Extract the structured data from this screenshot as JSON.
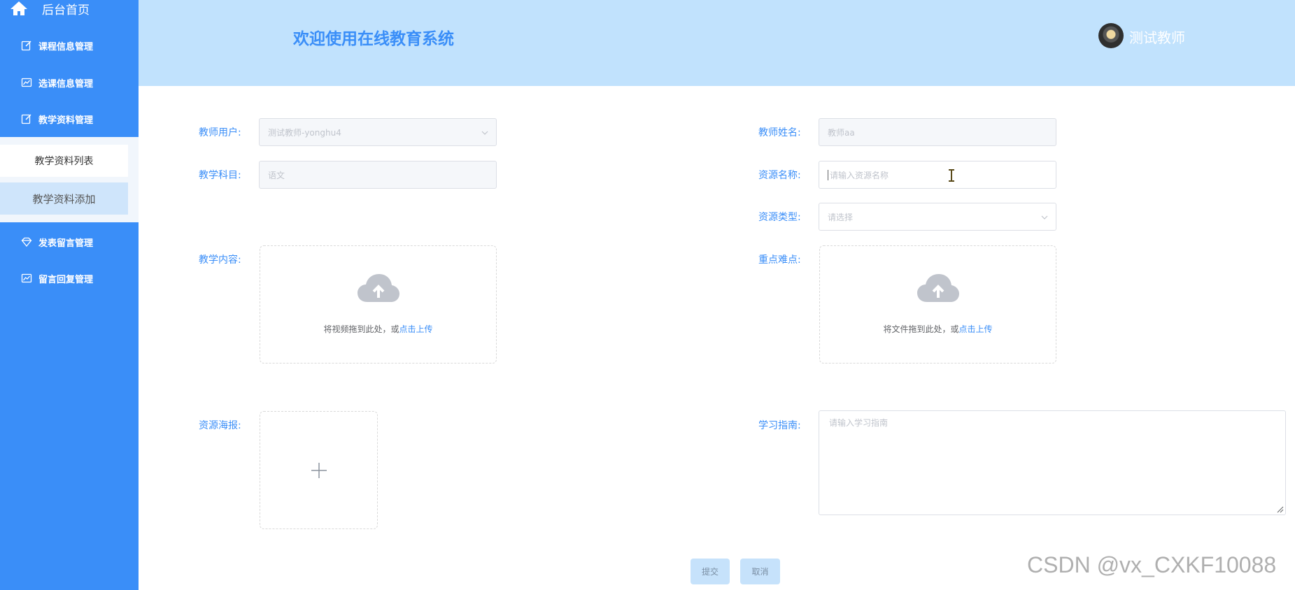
{
  "sidebar": {
    "home_label": "后台首页",
    "items": [
      {
        "label": "课程信息管理",
        "icon": "edit-icon"
      },
      {
        "label": "选课信息管理",
        "icon": "chart-icon"
      },
      {
        "label": "教学资料管理",
        "icon": "edit-icon"
      },
      {
        "label": "发表留言管理",
        "icon": "gem-icon"
      },
      {
        "label": "留言回复管理",
        "icon": "chart-icon"
      }
    ],
    "submenu": [
      {
        "label": "教学资料列表"
      },
      {
        "label": "教学资料添加"
      }
    ]
  },
  "header": {
    "title": "欢迎使用在线教育系统",
    "username": "测试教师"
  },
  "form": {
    "teacher_user": {
      "label": "教师用户:",
      "value": "测试教师-yonghu4"
    },
    "teacher_name": {
      "label": "教师姓名:",
      "value": "教师aa"
    },
    "subject": {
      "label": "教学科目:",
      "value": "语文"
    },
    "resource_name": {
      "label": "资源名称:",
      "placeholder": "请输入资源名称"
    },
    "resource_type": {
      "label": "资源类型:",
      "placeholder": "请选择"
    },
    "content": {
      "label": "教学内容:",
      "hint": "将视频拖到此处，或",
      "link": "点击上传"
    },
    "key_points": {
      "label": "重点难点:",
      "hint": "将文件拖到此处，或",
      "link": "点击上传"
    },
    "poster": {
      "label": "资源海报:"
    },
    "guide": {
      "label": "学习指南:",
      "placeholder": "请输入学习指南"
    },
    "submit_label": "提交",
    "cancel_label": "取消"
  },
  "watermark": "CSDN @vx_CXKF10088",
  "colors": {
    "sidebar": "#3a8ef8",
    "header": "#c1e2fd",
    "accent": "#3a8ef8",
    "submenu_active": "#cfe5fb"
  }
}
